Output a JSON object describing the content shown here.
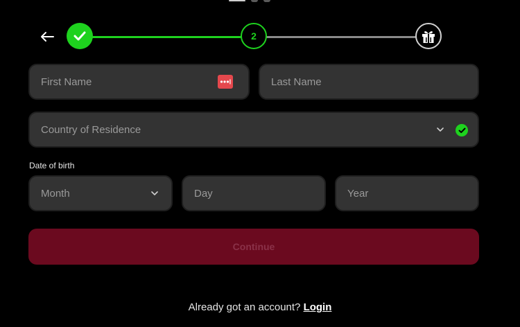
{
  "stepper": {
    "current_step": "2",
    "completed_icon": "check-icon",
    "final_icon": "gift-icon"
  },
  "form": {
    "first_name_placeholder": "First Name",
    "last_name_placeholder": "Last Name",
    "country_placeholder": "Country of Residence",
    "dob_label": "Date of birth",
    "month_placeholder": "Month",
    "day_placeholder": "Day",
    "year_placeholder": "Year",
    "continue_label": "Continue"
  },
  "footer": {
    "prompt": "Already got an account?",
    "login_label": "Login"
  },
  "colors": {
    "accent_green": "#1ed21e",
    "continue_bg": "#6b0a1f",
    "field_bg": "#333333",
    "password_manager_red": "#e5484d"
  }
}
